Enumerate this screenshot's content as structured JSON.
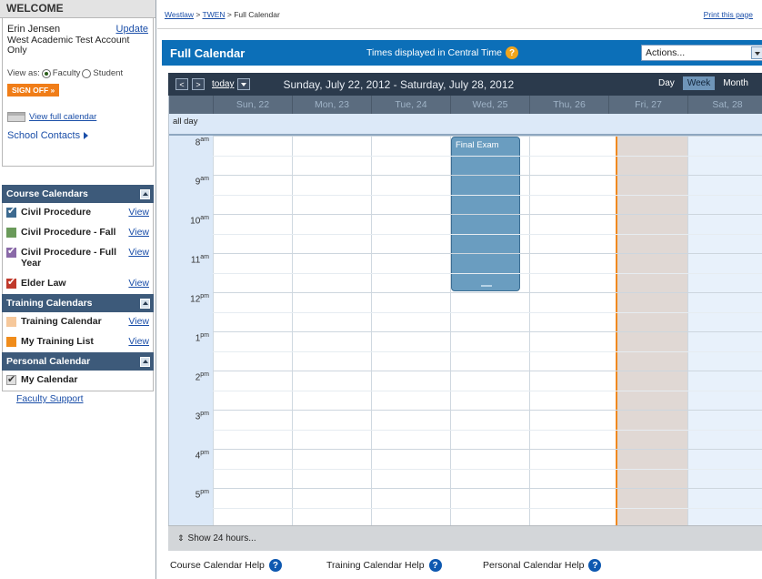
{
  "sidebar": {
    "welcome_title": "WELCOME",
    "user_name": "Erin Jensen",
    "update_link": "Update",
    "account": "West Academic Test Account Only",
    "view_as_label": "View as:",
    "view_as_faculty": "Faculty",
    "view_as_student": "Student",
    "sign_off": "SIGN OFF »",
    "view_full_calendar": "View full calendar",
    "school_contacts": "School Contacts",
    "course_section": "Course Calendars",
    "course_items": [
      {
        "label": "Civil Procedure",
        "color": "#3d6a8f",
        "checked": true,
        "view": "View"
      },
      {
        "label": "Civil Procedure - Fall",
        "color": "#6a9a5a",
        "checked": false,
        "view": "View"
      },
      {
        "label": "Civil Procedure - Full Year",
        "color": "#8a6aa8",
        "checked": true,
        "view": "View"
      },
      {
        "label": "Elder Law",
        "color": "#c0392b",
        "checked": true,
        "view": "View"
      }
    ],
    "training_section": "Training Calendars",
    "training_items": [
      {
        "label": "Training Calendar",
        "color": "#f6c89b",
        "view": "View"
      },
      {
        "label": "My Training List",
        "color": "#f08c1a",
        "view": "View"
      }
    ],
    "personal_section": "Personal Calendar",
    "personal_items": [
      {
        "label": "My Calendar",
        "color": "#e0e0e0"
      }
    ],
    "faculty_support": "Faculty Support"
  },
  "breadcrumb": {
    "westlaw": "Westlaw",
    "twen": "TWEN",
    "current": "Full Calendar",
    "separator": " > ",
    "print": "Print this page"
  },
  "header": {
    "title": "Full Calendar",
    "timezone": "Times displayed in Central Time",
    "actions": "Actions..."
  },
  "nav": {
    "prev": "<",
    "next": ">",
    "today": "today",
    "range": "Sunday, July 22, 2012 - Saturday, July 28, 2012",
    "views": [
      "Day",
      "Week",
      "Month"
    ],
    "active_view": "Week"
  },
  "days": [
    "Sun, 22",
    "Mon, 23",
    "Tue, 24",
    "Wed, 25",
    "Thu, 26",
    "Fri, 27",
    "Sat, 28"
  ],
  "all_day_label": "all day",
  "hours": [
    {
      "h": "8",
      "m": "am"
    },
    {
      "h": "9",
      "m": "am"
    },
    {
      "h": "10",
      "m": "am"
    },
    {
      "h": "11",
      "m": "am"
    },
    {
      "h": "12",
      "m": "pm"
    },
    {
      "h": "1",
      "m": "pm"
    },
    {
      "h": "2",
      "m": "pm"
    },
    {
      "h": "3",
      "m": "pm"
    },
    {
      "h": "4",
      "m": "pm"
    },
    {
      "h": "5",
      "m": "pm"
    }
  ],
  "event": {
    "title": "Final Exam",
    "day": "Wed, 25"
  },
  "show_24": "Show 24 hours...",
  "footer": {
    "course_help": "Course Calendar Help",
    "training_help": "Training Calendar Help",
    "personal_help": "Personal Calendar Help"
  }
}
